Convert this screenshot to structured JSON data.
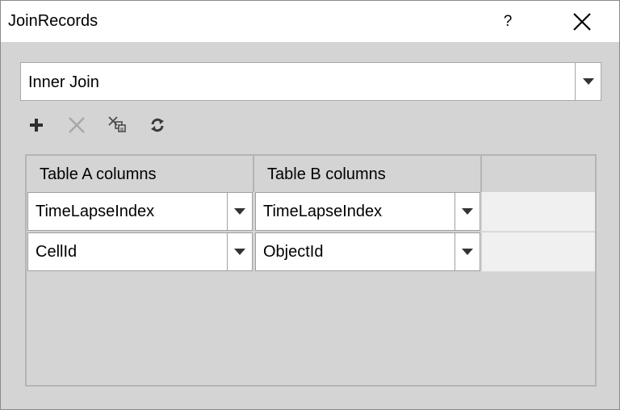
{
  "window": {
    "title": "JoinRecords",
    "help_label": "?"
  },
  "join_type": {
    "selected": "Inner Join"
  },
  "toolbar": {
    "icons": [
      "add-icon",
      "delete-icon",
      "clear-mappings-icon",
      "refresh-icon"
    ],
    "delete_enabled": false
  },
  "grid": {
    "columns": [
      "Table A columns",
      "Table B columns"
    ],
    "rows": [
      {
        "a": "TimeLapseIndex",
        "b": "TimeLapseIndex"
      },
      {
        "a": "CellId",
        "b": "ObjectId"
      }
    ]
  },
  "colors": {
    "panel_background": "#d4d4d4",
    "field_background": "#ffffff",
    "disabled_icon": "#a8a8a8"
  }
}
